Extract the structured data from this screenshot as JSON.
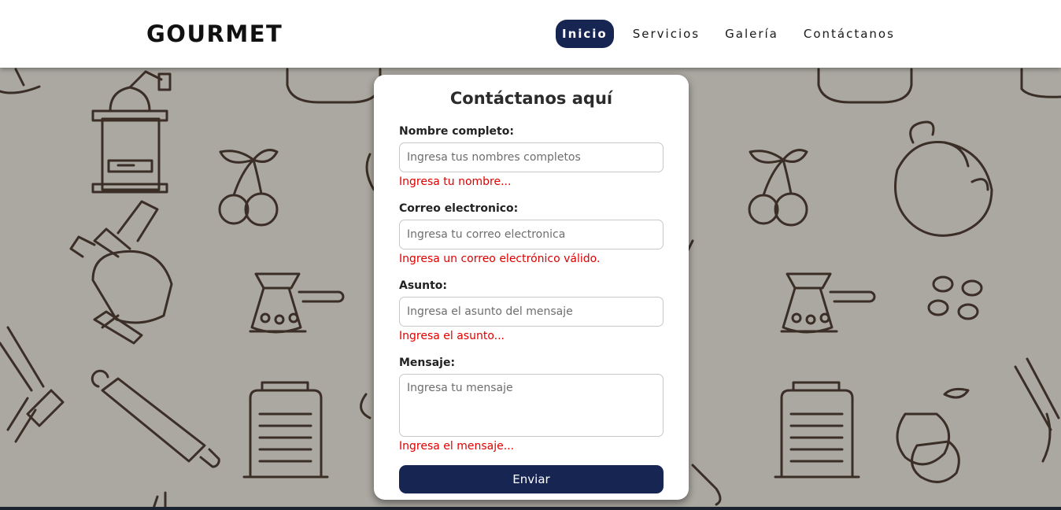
{
  "header": {
    "logo": "GOURMET",
    "nav": [
      {
        "label": "Inicio",
        "active": true
      },
      {
        "label": "Servicios",
        "active": false
      },
      {
        "label": "Galería",
        "active": false
      },
      {
        "label": "Contáctanos",
        "active": false
      }
    ]
  },
  "form": {
    "title": "Contáctanos aquí",
    "fields": [
      {
        "label": "Nombre completo:",
        "placeholder": "Ingresa tus nombres completos",
        "value": "",
        "error": "Ingresa tu nombre..."
      },
      {
        "label": "Correo electronico:",
        "placeholder": "Ingresa tu correo electronica",
        "value": "",
        "error": "Ingresa un correo electrónico válido."
      },
      {
        "label": "Asunto:",
        "placeholder": "Ingresa el asunto del mensaje",
        "value": "",
        "error": "Ingresa el asunto..."
      },
      {
        "label": "Mensaje:",
        "placeholder": "Ingresa tu mensaje",
        "value": "",
        "error": "Ingresa el mensaje..."
      }
    ],
    "submit_label": "Enviar"
  },
  "colors": {
    "accent": "#172552",
    "error": "#e00000",
    "background": "#aba8a1",
    "sketch": "#3a2e26"
  },
  "background_pattern": {
    "icons": [
      "coffee-grinder-icon",
      "cherries-icon",
      "meat-grinder-icon",
      "coffee-pot-icon",
      "whisk-icon",
      "rolling-pin-icon",
      "grater-icon",
      "kettle-icon",
      "coffee-beans-icon",
      "pear-apple-icon"
    ]
  }
}
